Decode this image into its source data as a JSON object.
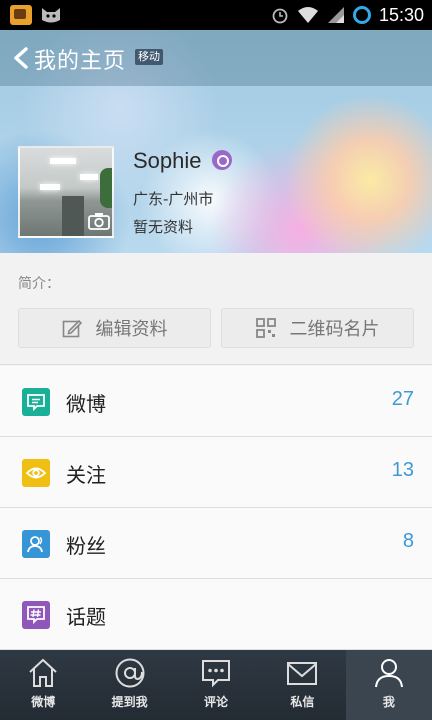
{
  "status_bar": {
    "time": "15:30"
  },
  "header": {
    "title": "我的主页",
    "network_badge": "移动"
  },
  "profile": {
    "name": "Sophie",
    "location": "广东-广州市",
    "profile_status": "暂无资料"
  },
  "intro": {
    "label": "简介："
  },
  "actions": {
    "edit_label": "编辑资料",
    "qr_label": "二维码名片"
  },
  "list": [
    {
      "label": "微博",
      "count": "27",
      "icon": "weibo-icon",
      "color": "#1aaf97"
    },
    {
      "label": "关注",
      "count": "13",
      "icon": "eye-icon",
      "color": "#efbf13"
    },
    {
      "label": "粉丝",
      "count": "8",
      "icon": "fans-icon",
      "color": "#3595d6"
    },
    {
      "label": "话题",
      "count": "",
      "icon": "topic-icon",
      "color": "#8e57b9"
    }
  ],
  "tabs": [
    {
      "label": "微博",
      "icon": "home-icon"
    },
    {
      "label": "提到我",
      "icon": "at-icon"
    },
    {
      "label": "评论",
      "icon": "comment-icon"
    },
    {
      "label": "私信",
      "icon": "mail-icon"
    },
    {
      "label": "我",
      "icon": "person-icon",
      "active": true
    }
  ],
  "colors": {
    "accent": "#3d9ad6",
    "tabbar": "#2a333c"
  }
}
